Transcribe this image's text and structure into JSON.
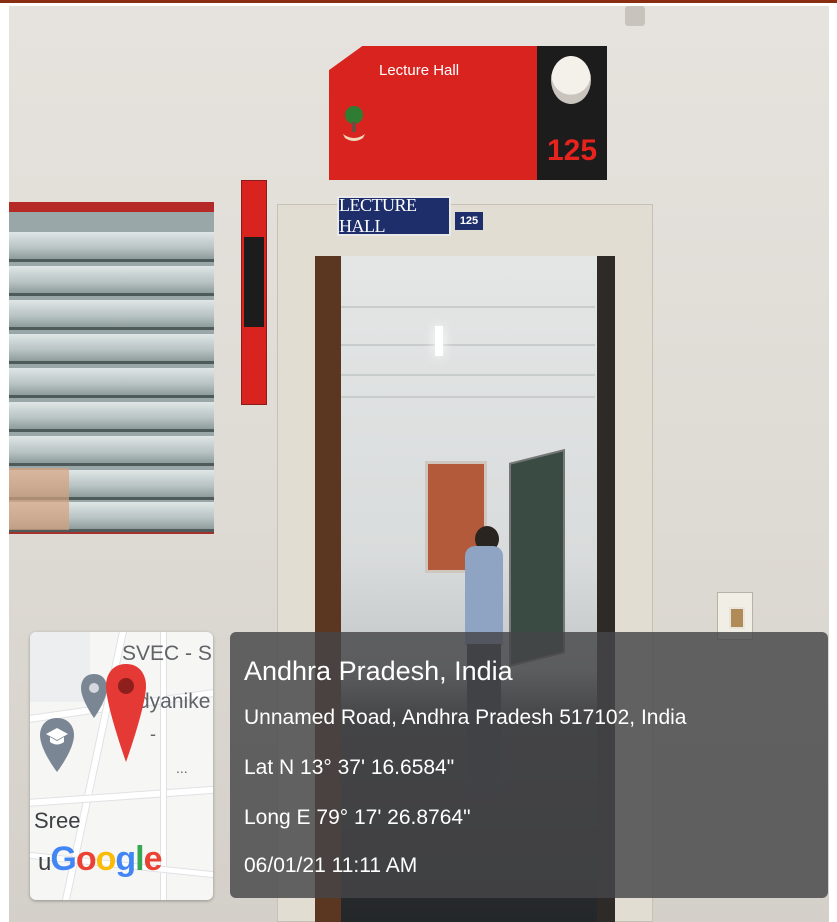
{
  "signage": {
    "main_sign_title": "Lecture Hall",
    "main_sign_number": "125",
    "door_plate_label": "LECTURE HALL",
    "door_plate_number": "125"
  },
  "map": {
    "place_label_1": "SVEC - Si",
    "place_label_2": "dyanike",
    "place_label_3": "Sree",
    "dash": "-",
    "dots": "...",
    "logo_prefix": "u",
    "logo": "Google",
    "logo_colors": [
      "#4285F4",
      "#EA4335",
      "#FBBC05",
      "#4285F4",
      "#34A853",
      "#EA4335"
    ],
    "pin_color": "#E53935"
  },
  "geo": {
    "title": "Andhra Pradesh, India",
    "address": "Unnamed Road, Andhra Pradesh 517102, India",
    "latitude": "Lat N 13° 37' 16.6584\"",
    "longitude": "Long E 79° 17' 26.8764\"",
    "timestamp": "06/01/21 11:11 AM"
  }
}
